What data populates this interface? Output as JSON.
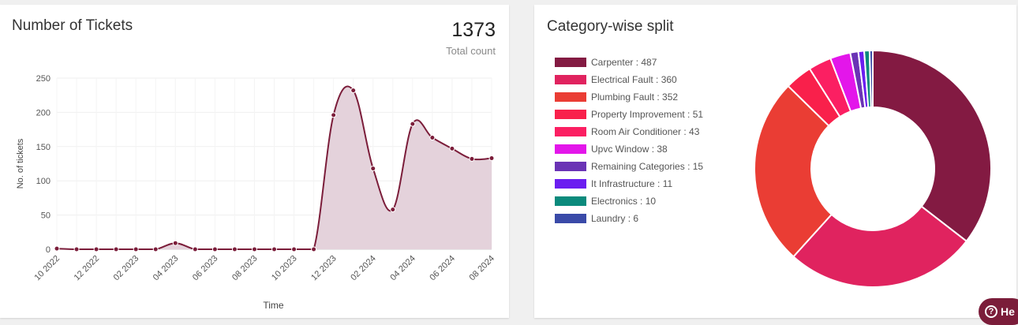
{
  "tickets_card": {
    "title": "Number of Tickets",
    "total_value": "1373",
    "total_label": "Total count"
  },
  "split_card": {
    "title": "Category-wise split"
  },
  "help_button": {
    "label": "He"
  },
  "chart_data": [
    {
      "type": "area",
      "xlabel": "Time",
      "ylabel": "No. of tickets",
      "ylim": [
        0,
        250
      ],
      "yticks": [
        0,
        50,
        100,
        150,
        200,
        250
      ],
      "x": [
        "10 2022",
        "11 2022",
        "12 2022",
        "01 2023",
        "02 2023",
        "03 2023",
        "04 2023",
        "05 2023",
        "06 2023",
        "07 2023",
        "08 2023",
        "09 2023",
        "10 2023",
        "11 2023",
        "12 2023",
        "01 2024",
        "02 2024",
        "03 2024",
        "04 2024",
        "05 2024",
        "06 2024",
        "07 2024",
        "08 2024"
      ],
      "xtick_labels": [
        "10 2022",
        "12 2022",
        "02 2023",
        "04 2023",
        "06 2023",
        "08 2023",
        "10 2023",
        "12 2023",
        "02 2024",
        "04 2024",
        "06 2024",
        "08 2024"
      ],
      "values": [
        1,
        0,
        0,
        0,
        0,
        9,
        0,
        0,
        0,
        0,
        0,
        0,
        0,
        196,
        232,
        118,
        58,
        183,
        163,
        147,
        132,
        133
      ],
      "values_by_month": [
        1,
        0,
        0,
        0,
        0,
        0,
        9,
        0,
        0,
        0,
        0,
        0,
        0,
        0,
        196,
        232,
        118,
        58,
        183,
        163,
        147,
        132,
        133
      ],
      "grid": true,
      "colors": {
        "line": "#7b1d3a",
        "fill": "#e4d2db"
      }
    },
    {
      "type": "pie",
      "donut": true,
      "legend_position": "left",
      "slices": [
        {
          "label": "Carpenter : 487",
          "value": 487,
          "color": "#831a42"
        },
        {
          "label": "Electrical Fault : 360",
          "value": 360,
          "color": "#e0235f"
        },
        {
          "label": "Plumbing Fault : 352",
          "value": 352,
          "color": "#ea3d34"
        },
        {
          "label": "Property Improvement : 51",
          "value": 51,
          "color": "#f9204b"
        },
        {
          "label": "Room Air Conditioner : 43",
          "value": 43,
          "color": "#fb1f62"
        },
        {
          "label": "Upvc Window : 38",
          "value": 38,
          "color": "#e316ea"
        },
        {
          "label": "Remaining Categories : 15",
          "value": 15,
          "color": "#6a33b5"
        },
        {
          "label": "It Infrastructure : 11",
          "value": 11,
          "color": "#6b1ef0"
        },
        {
          "label": "Electronics : 10",
          "value": 10,
          "color": "#0b8a7c"
        },
        {
          "label": "Laundry : 6",
          "value": 6,
          "color": "#3a4aa8"
        }
      ]
    }
  ]
}
